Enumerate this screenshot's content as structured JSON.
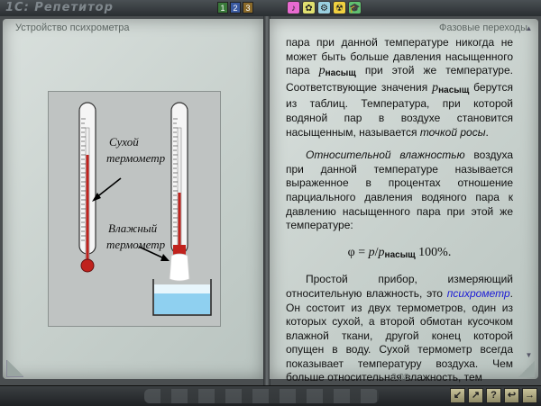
{
  "app": {
    "title": "1С: Репетитор",
    "top_icons": [
      "1",
      "2",
      "3"
    ],
    "mode_icons": [
      "♪",
      "✿",
      "⚙",
      "☢",
      "🎓"
    ]
  },
  "left_page": {
    "header": "Устройство психрометра",
    "figure": {
      "dry_label_1": "Сухой",
      "dry_label_2": "термометр",
      "wet_label_1": "Влажный",
      "wet_label_2": "термометр"
    }
  },
  "right_page": {
    "header": "Фазовые переходы",
    "para1_a": "пара при данной температуре никогда не может быть больше давления насыщенного пара ",
    "para1_var": "p",
    "para1_sub": "насыщ",
    "para1_b": " при этой же температуре. Соответствующие значения ",
    "para1_var2": "p",
    "para1_sub2": "насыщ",
    "para1_c": " берутся из таблиц. Температура, при которой водяной пар в воздухе становится насыщенным, называется ",
    "para1_term": "точкой росы",
    "para1_end": ".",
    "para2_term": "Относительной влажностью",
    "para2_text": " воздуха при данной температуре называется выраженное в процентах отношение парциального давления водяного пара к давлению насыщенного пара при этой же температуре:",
    "formula_lhs": "φ = ",
    "formula_p": "p",
    "formula_slash": "/",
    "formula_p2": "p",
    "formula_sub": "насыщ",
    "formula_rhs": " 100%.",
    "para3_a": "Простой прибор, измеряющий относительную влажность, это ",
    "para3_link": "психрометр",
    "para3_b": ". Он состоит из двух термометров, один из которых сухой, а второй обмотан кусочком влажной ткани, другой конец которой опущен в воду. Сухой термометр всегда показывает температуру воздуха. Чем больше относительная влажность, тем",
    "page_number": "2.08"
  },
  "bottom": {
    "nav_buttons": [
      "↙",
      "↗",
      "?",
      "↩",
      "→"
    ]
  },
  "colors": {
    "page": "#c7d0cc",
    "link": "#1b1bd6",
    "mercury": "#c0221d",
    "water": "#8fd0f0"
  }
}
